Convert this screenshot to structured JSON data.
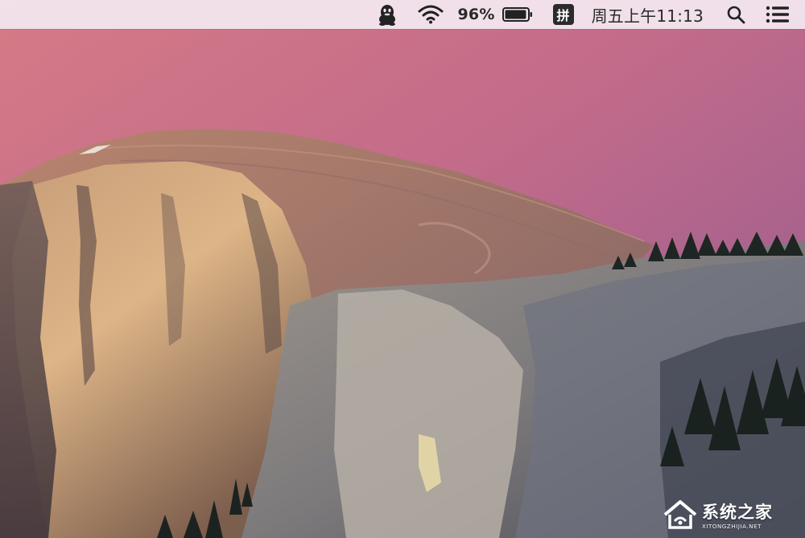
{
  "menubar": {
    "icons": [
      "qq-penguin-icon",
      "wifi-icon",
      "battery-icon",
      "search-icon",
      "list-icon"
    ],
    "battery_percent": "96%",
    "battery_level": 0.96,
    "input_method": "拼",
    "clock": "周五上午11:13"
  },
  "watermark": {
    "title": "系统之家",
    "url": "XITONGZHIJIA.NET"
  },
  "colors": {
    "menubar_bg": "#f4e8f0",
    "sky_top": "#c46e86",
    "sky_bottom": "#9a5b8f"
  }
}
